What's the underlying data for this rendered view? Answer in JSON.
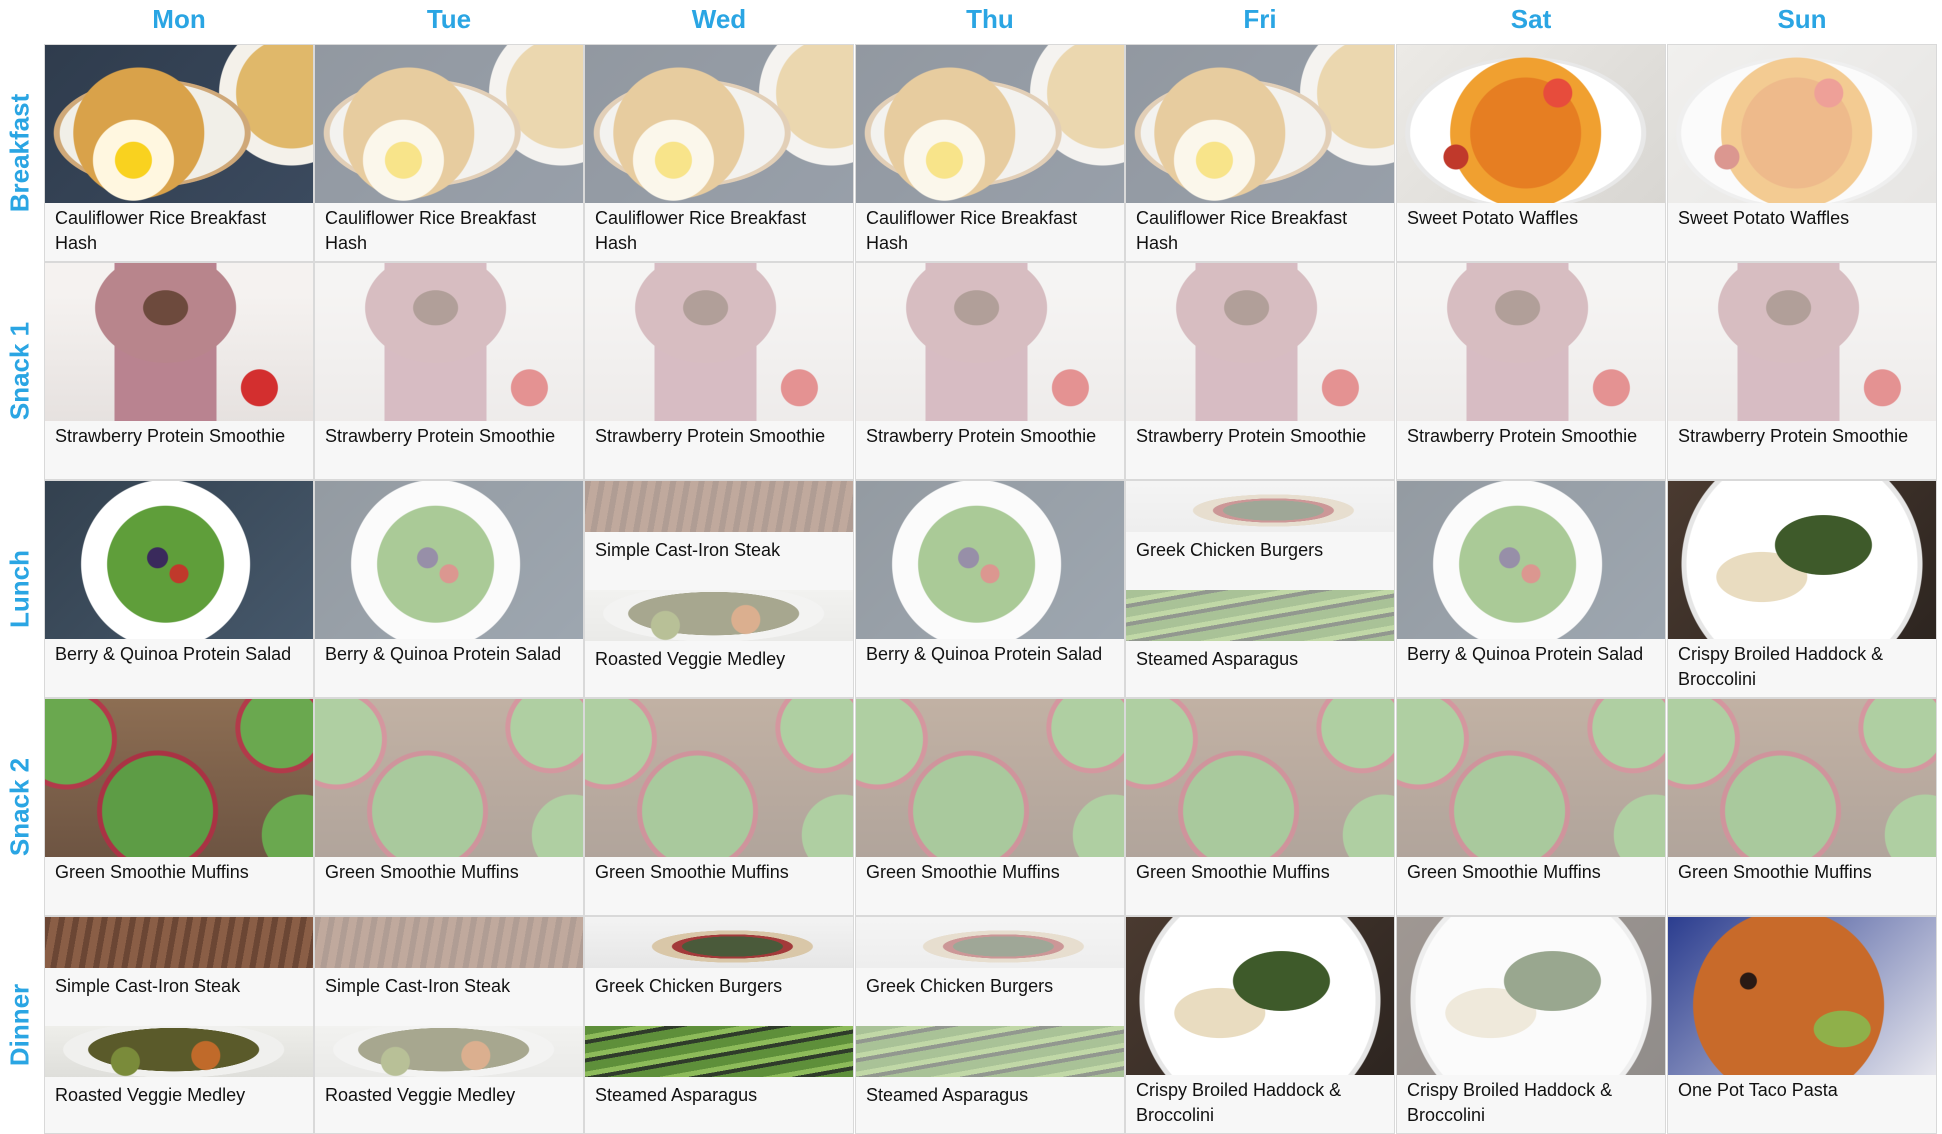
{
  "days": [
    "Mon",
    "Tue",
    "Wed",
    "Thu",
    "Fri",
    "Sat",
    "Sun"
  ],
  "meals": [
    "Breakfast",
    "Snack 1",
    "Lunch",
    "Snack 2",
    "Dinner"
  ],
  "grid": [
    [
      {
        "items": [
          {
            "title": "Cauliflower Rice Breakfast Hash",
            "image": "hash"
          }
        ],
        "faded": false
      },
      {
        "items": [
          {
            "title": "Strawberry Protein Smoothie",
            "image": "smoothie"
          }
        ],
        "faded": false
      },
      {
        "items": [
          {
            "title": "Berry & Quinoa Protein Salad",
            "image": "salad"
          }
        ],
        "faded": false
      },
      {
        "items": [
          {
            "title": "Green Smoothie Muffins",
            "image": "muffin"
          }
        ],
        "faded": false
      },
      {
        "items": [
          {
            "title": "Simple Cast-Iron Steak",
            "image": "steak"
          },
          {
            "title": "Roasted Veggie Medley",
            "image": "veggie"
          }
        ],
        "faded": false
      }
    ],
    [
      {
        "items": [
          {
            "title": "Cauliflower Rice Breakfast Hash",
            "image": "hash"
          }
        ],
        "faded": true
      },
      {
        "items": [
          {
            "title": "Strawberry Protein Smoothie",
            "image": "smoothie"
          }
        ],
        "faded": true
      },
      {
        "items": [
          {
            "title": "Berry & Quinoa Protein Salad",
            "image": "salad"
          }
        ],
        "faded": true
      },
      {
        "items": [
          {
            "title": "Green Smoothie Muffins",
            "image": "muffin"
          }
        ],
        "faded": true
      },
      {
        "items": [
          {
            "title": "Simple Cast-Iron Steak",
            "image": "steak"
          },
          {
            "title": "Roasted Veggie Medley",
            "image": "veggie"
          }
        ],
        "faded": true
      }
    ],
    [
      {
        "items": [
          {
            "title": "Cauliflower Rice Breakfast Hash",
            "image": "hash"
          }
        ],
        "faded": true
      },
      {
        "items": [
          {
            "title": "Strawberry Protein Smoothie",
            "image": "smoothie"
          }
        ],
        "faded": true
      },
      {
        "items": [
          {
            "title": "Simple Cast-Iron Steak",
            "image": "steak"
          },
          {
            "title": "Roasted Veggie Medley",
            "image": "veggie"
          }
        ],
        "faded": true
      },
      {
        "items": [
          {
            "title": "Green Smoothie Muffins",
            "image": "muffin"
          }
        ],
        "faded": true
      },
      {
        "items": [
          {
            "title": "Greek Chicken Burgers",
            "image": "burger"
          },
          {
            "title": "Steamed Asparagus",
            "image": "asparagus"
          }
        ],
        "faded": false
      }
    ],
    [
      {
        "items": [
          {
            "title": "Cauliflower Rice Breakfast Hash",
            "image": "hash"
          }
        ],
        "faded": true
      },
      {
        "items": [
          {
            "title": "Strawberry Protein Smoothie",
            "image": "smoothie"
          }
        ],
        "faded": true
      },
      {
        "items": [
          {
            "title": "Berry & Quinoa Protein Salad",
            "image": "salad"
          }
        ],
        "faded": true
      },
      {
        "items": [
          {
            "title": "Green Smoothie Muffins",
            "image": "muffin"
          }
        ],
        "faded": true
      },
      {
        "items": [
          {
            "title": "Greek Chicken Burgers",
            "image": "burger"
          },
          {
            "title": "Steamed Asparagus",
            "image": "asparagus"
          }
        ],
        "faded": true
      }
    ],
    [
      {
        "items": [
          {
            "title": "Cauliflower Rice Breakfast Hash",
            "image": "hash"
          }
        ],
        "faded": true
      },
      {
        "items": [
          {
            "title": "Strawberry Protein Smoothie",
            "image": "smoothie"
          }
        ],
        "faded": true
      },
      {
        "items": [
          {
            "title": "Greek Chicken Burgers",
            "image": "burger"
          },
          {
            "title": "Steamed Asparagus",
            "image": "asparagus"
          }
        ],
        "faded": true
      },
      {
        "items": [
          {
            "title": "Green Smoothie Muffins",
            "image": "muffin"
          }
        ],
        "faded": true
      },
      {
        "items": [
          {
            "title": "Crispy Broiled Haddock & Broccolini",
            "image": "haddock"
          }
        ],
        "faded": false
      }
    ],
    [
      {
        "items": [
          {
            "title": "Sweet Potato Waffles",
            "image": "waffle"
          }
        ],
        "faded": false
      },
      {
        "items": [
          {
            "title": "Strawberry Protein Smoothie",
            "image": "smoothie"
          }
        ],
        "faded": true
      },
      {
        "items": [
          {
            "title": "Berry & Quinoa Protein Salad",
            "image": "salad"
          }
        ],
        "faded": true
      },
      {
        "items": [
          {
            "title": "Green Smoothie Muffins",
            "image": "muffin"
          }
        ],
        "faded": true
      },
      {
        "items": [
          {
            "title": "Crispy Broiled Haddock & Broccolini",
            "image": "haddock"
          }
        ],
        "faded": true
      }
    ],
    [
      {
        "items": [
          {
            "title": "Sweet Potato Waffles",
            "image": "waffle"
          }
        ],
        "faded": true
      },
      {
        "items": [
          {
            "title": "Strawberry Protein Smoothie",
            "image": "smoothie"
          }
        ],
        "faded": true
      },
      {
        "items": [
          {
            "title": "Crispy Broiled Haddock & Broccolini",
            "image": "haddock"
          }
        ],
        "faded": false
      },
      {
        "items": [
          {
            "title": "Green Smoothie Muffins",
            "image": "muffin"
          }
        ],
        "faded": true
      },
      {
        "items": [
          {
            "title": "One Pot Taco Pasta",
            "image": "tacopasta"
          }
        ],
        "faded": false
      }
    ]
  ],
  "colors": {
    "accent": "#2aa5e3",
    "caption_bg": "#f7f7f7",
    "border": "#d9d9d9"
  }
}
